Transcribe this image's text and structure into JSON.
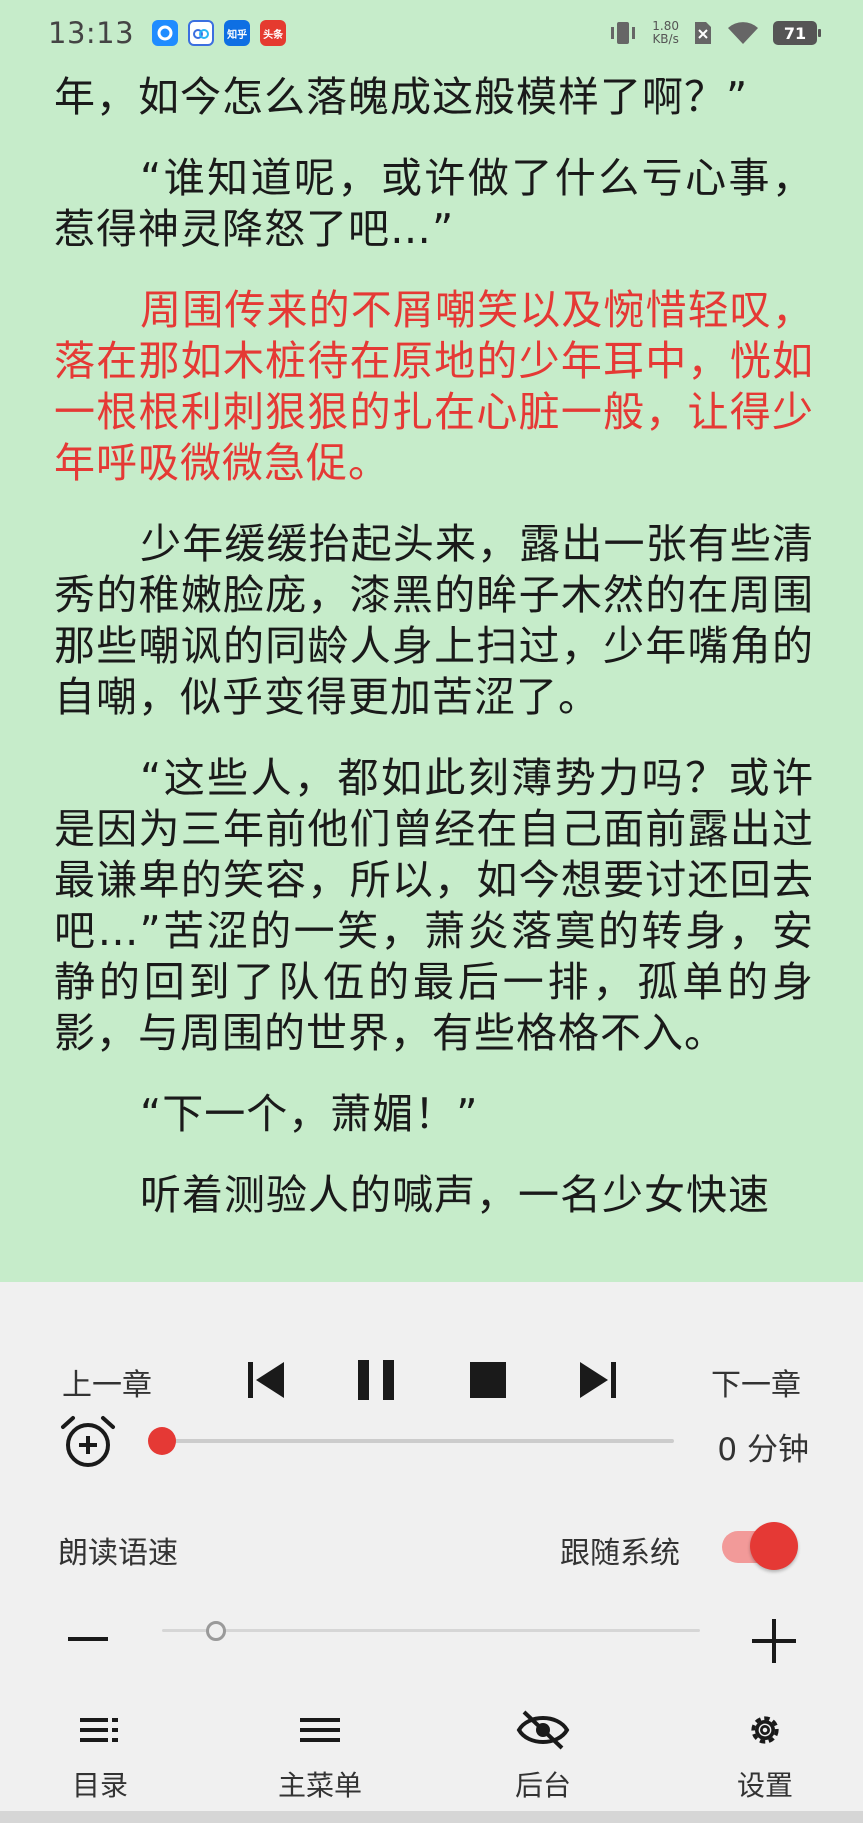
{
  "status_bar": {
    "time": "13:13",
    "notifications": [
      {
        "name": "qq-browser-icon",
        "text": ""
      },
      {
        "name": "baidu-netdisk-icon",
        "text": ""
      },
      {
        "name": "zhihu-icon",
        "text": "知乎"
      },
      {
        "name": "toutiao-icon",
        "text": "头条"
      }
    ],
    "network_speed_value": "1.80",
    "network_speed_unit": "KB/s",
    "battery": "71"
  },
  "reader": {
    "paragraphs": [
      {
        "text": "年，如今怎么落魄成这般模样了啊？”",
        "indent": false,
        "highlight": false
      },
      {
        "text": "“谁知道呢，或许做了什么亏心事，惹得神灵降怒了吧…”",
        "indent": true,
        "highlight": false
      },
      {
        "text": "周围传来的不屑嘲笑以及惋惜轻叹，落在那如木桩待在原地的少年耳中，恍如一根根利刺狠狠的扎在心脏一般，让得少年呼吸微微急促。",
        "indent": true,
        "highlight": true
      },
      {
        "text": "少年缓缓抬起头来，露出一张有些清秀的稚嫩脸庞，漆黑的眸子木然的在周围那些嘲讽的同龄人身上扫过，少年嘴角的自嘲，似乎变得更加苦涩了。",
        "indent": true,
        "highlight": false
      },
      {
        "text": "“这些人，都如此刻薄势力吗？或许是因为三年前他们曾经在自己面前露出过最谦卑的笑容，所以，如今想要讨还回去吧…”苦涩的一笑，萧炎落寞的转身，安静的回到了队伍的最后一排，孤单的身影，与周围的世界，有些格格不入。",
        "indent": true,
        "highlight": false
      },
      {
        "text": "“下一个，萧媚！”",
        "indent": true,
        "highlight": false
      },
      {
        "text": "听着测验人的喊声，一名少女快速",
        "indent": true,
        "highlight": false
      }
    ]
  },
  "controls": {
    "prev_chapter": "上一章",
    "next_chapter": "下一章",
    "timer_label": "0 分钟",
    "timer_value_minutes": 0,
    "speed_label": "朗读语速",
    "follow_system_label": "跟随系统",
    "follow_system_on": true,
    "speed_fraction": 0.1
  },
  "bottom_nav": {
    "toc": "目录",
    "main_menu": "主菜单",
    "background": "后台",
    "settings": "设置"
  },
  "colors": {
    "reader_bg": "#c6ecca",
    "highlight": "#e53935",
    "accent": "#e53935",
    "panel_bg": "#f0f0f0"
  }
}
